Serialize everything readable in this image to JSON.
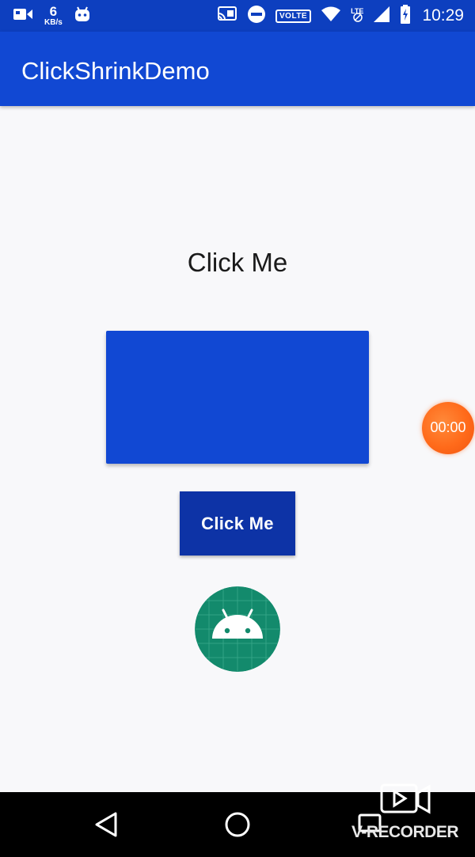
{
  "status_bar": {
    "net_speed_value": "6",
    "net_speed_unit": "KB/s",
    "volte_label": "VOLTE",
    "lte_label": "LTE",
    "time": "10:29"
  },
  "app_bar": {
    "title": "ClickShrinkDemo"
  },
  "main": {
    "click_text": "Click Me",
    "click_button_label": "Click Me"
  },
  "recorder": {
    "timer": "00:00",
    "watermark": "V-RECORDER"
  },
  "colors": {
    "status_bar": "#0d3fbf",
    "app_bar": "#1148d3",
    "button": "#0d33a6",
    "timer_bubble": "#ff6a1a"
  }
}
